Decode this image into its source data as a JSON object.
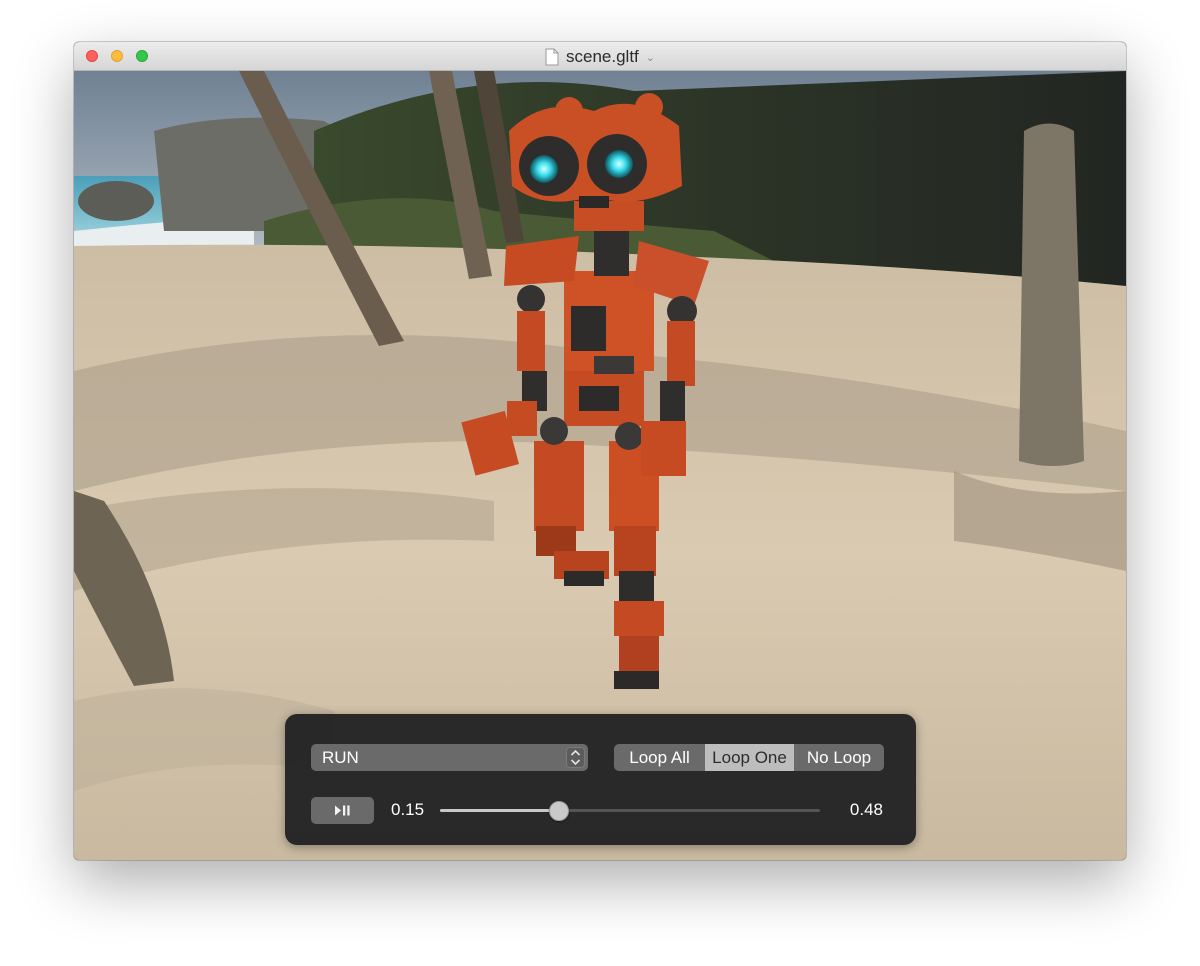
{
  "window": {
    "title": "scene.gltf",
    "document_icon": "document-icon",
    "title_menu_icon": "chevron-down-icon",
    "traffic_lights": {
      "close": "#fc605c",
      "minimize": "#fdbc40",
      "maximize": "#34c84a"
    }
  },
  "viewport": {
    "content": "3D scene: orange robot model on a sandy beach with palm tree trunks"
  },
  "controls": {
    "animation_select": {
      "value": "RUN",
      "icon": "stepper-arrows-icon"
    },
    "loop_modes": {
      "options": [
        "Loop All",
        "Loop One",
        "No Loop"
      ],
      "selected": "Loop One"
    },
    "play_pause": {
      "icon": "play-pause-icon"
    },
    "current_time": "0.15",
    "duration": "0.48",
    "scrub_progress": 0.3125
  }
}
